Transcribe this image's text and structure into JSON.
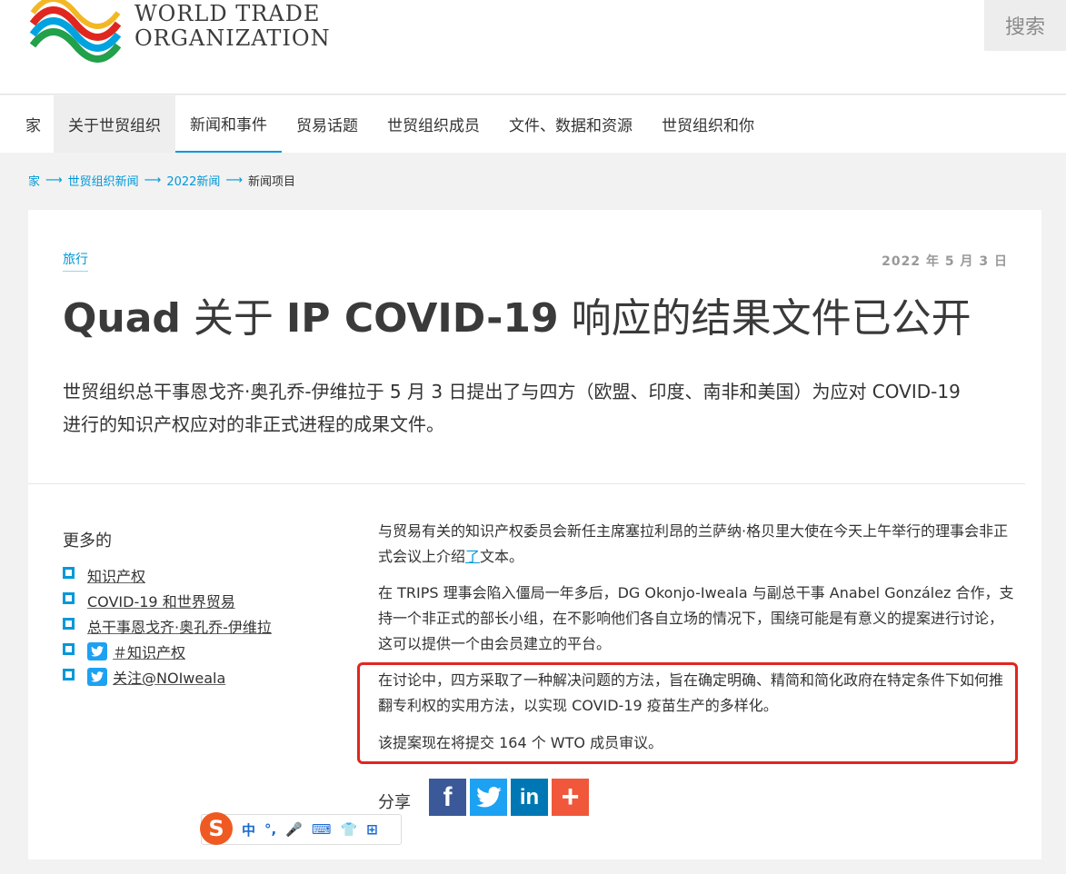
{
  "header": {
    "logo_line1": "WORLD TRADE",
    "logo_line2": "ORGANIZATION",
    "search_label": "搜索"
  },
  "nav": {
    "items": [
      {
        "label": "家"
      },
      {
        "label": "关于世贸组织"
      },
      {
        "label": "新闻和事件"
      },
      {
        "label": "贸易话题"
      },
      {
        "label": "世贸组织成员"
      },
      {
        "label": "文件、数据和资源"
      },
      {
        "label": "世贸组织和你"
      }
    ]
  },
  "breadcrumb": {
    "items": [
      "家",
      "世贸组织新闻",
      "2022新闻"
    ],
    "separator": "⟶",
    "current": "新闻项目"
  },
  "article": {
    "tag": "旅行",
    "date": "2022 年 5 月 3 日",
    "title_latin": "Quad",
    "title_cn1": " 关于 ",
    "title_latin2": "IP COVID-19",
    "title_cn2": " 响应的结果文件已公开",
    "lead": "世贸组织总干事恩戈齐·奥孔乔-伊维拉于 5 月 3 日提出了与四方（欧盟、印度、南非和美国）为应对 COVID-19 进行的知识产权应对的非正式进程的成果文件。",
    "para1_a": "与贸易有关的知识产权委员会新任主席塞拉利昂的兰萨纳·格贝里大使在今天上午举行的理事会非正式会议上介绍",
    "para1_link": "了",
    "para1_b": "文本。",
    "para2": "在 TRIPS 理事会陷入僵局一年多后，DG Okonjo-Iweala 与副总干事 Anabel González 合作，支持一个非正式的部长小组，在不影响他们各自立场的情况下，围绕可能是有意义的提案进行讨论，这可以提供一个由会员建立的平台。",
    "para3": "在讨论中，四方采取了一种解决问题的方法，旨在确定明确、精简和简化政府在特定条件下如何推翻专利权的实用方法，以实现 COVID-19 疫苗生产的多样化。",
    "para4": "该提案现在将提交 164 个 WTO 成员审议。",
    "share_label": "分享"
  },
  "sidebar": {
    "title": "更多的",
    "links": [
      {
        "label": "知识产权"
      },
      {
        "label": "COVID-19 和世界贸易"
      },
      {
        "label": "总干事恩戈齐·奥孔乔-伊维拉"
      },
      {
        "label": "＃知识产权"
      },
      {
        "label": "关注@NOIweala"
      }
    ]
  },
  "share": {
    "facebook": "f",
    "linkedin": "in",
    "more": "+"
  },
  "ime": {
    "logo": "S",
    "items": [
      "中",
      "°,",
      "🎤",
      "⌨",
      "👕",
      "⊞"
    ]
  },
  "colors": {
    "accent": "#0098d8",
    "highlight_border": "#e0261e",
    "facebook": "#3b5998",
    "twitter": "#1da1f2",
    "linkedin": "#0077b5",
    "more": "#f1573a"
  }
}
